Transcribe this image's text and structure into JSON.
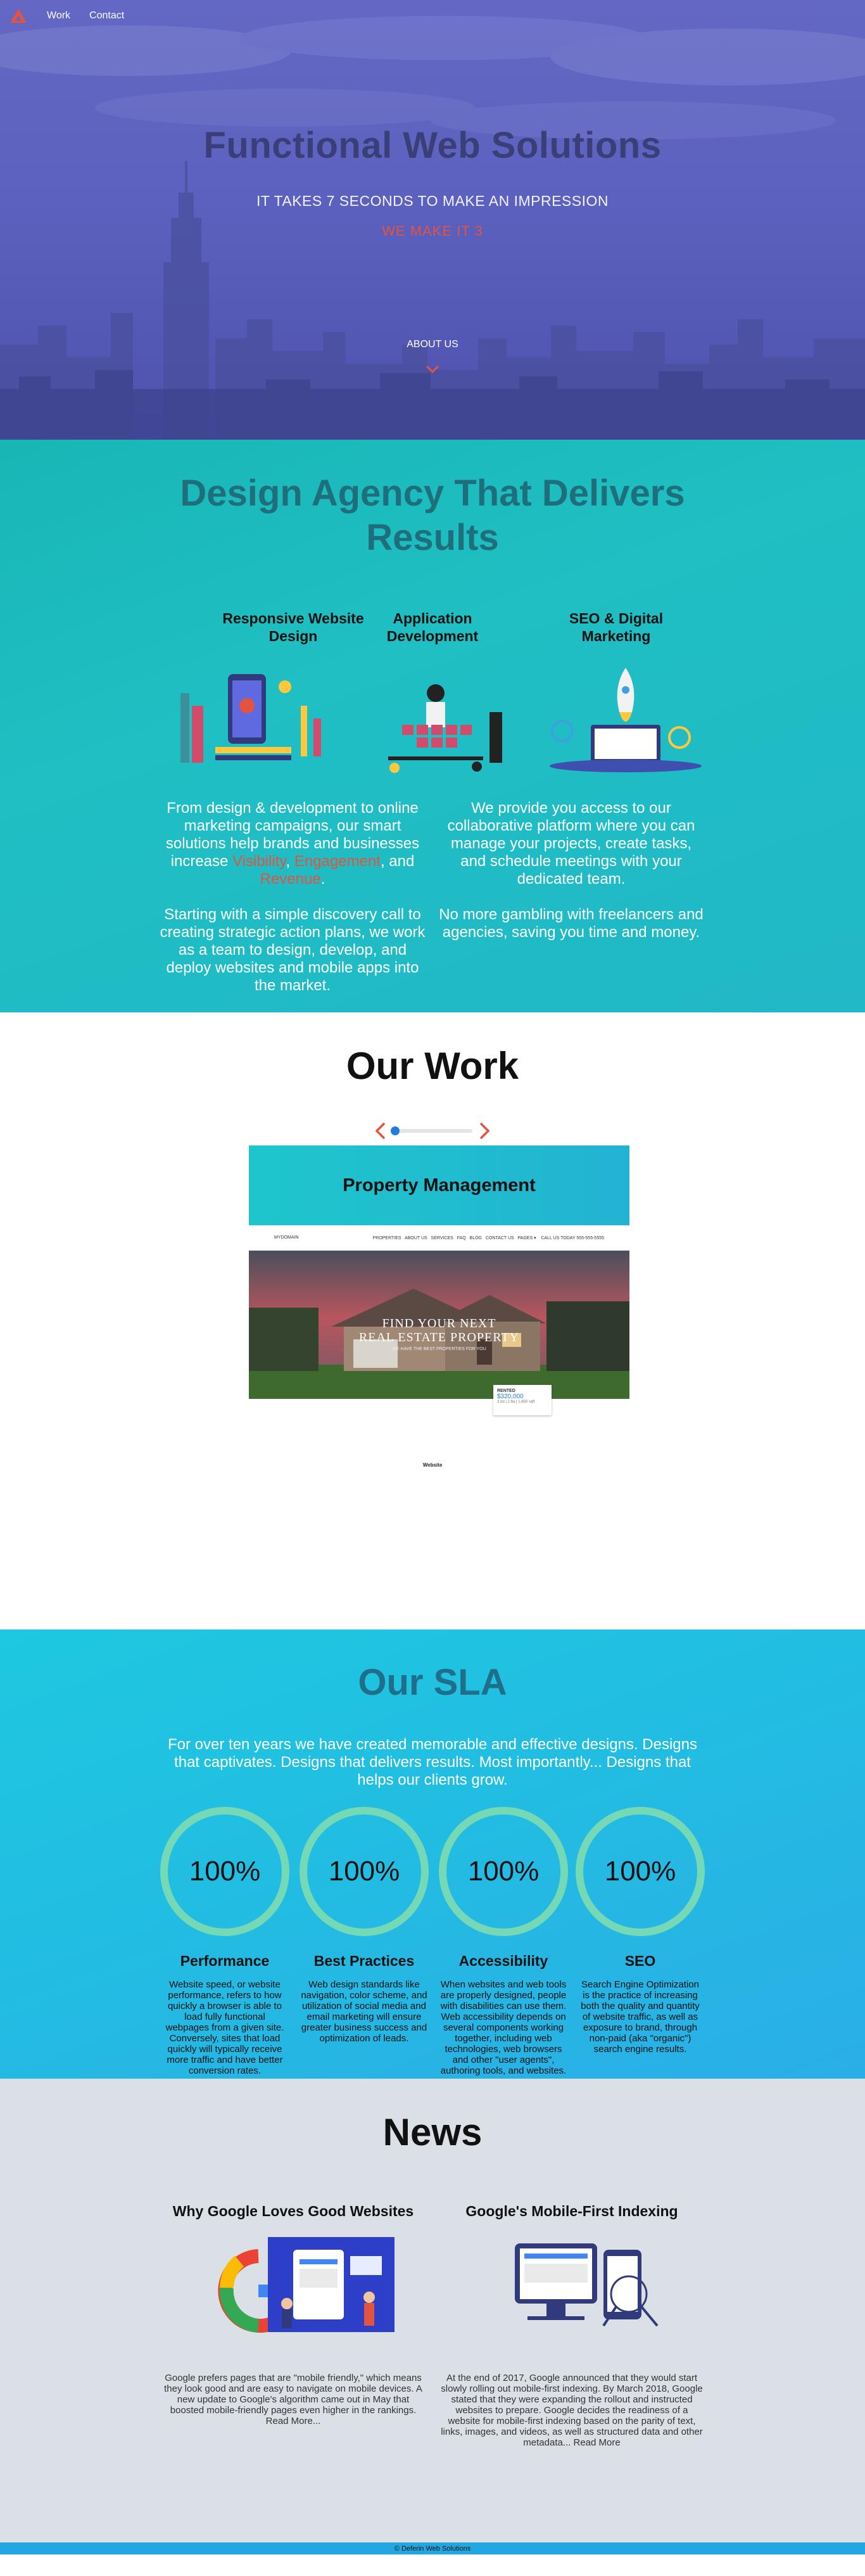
{
  "nav": {
    "links": [
      "Work",
      "Contact"
    ]
  },
  "hero": {
    "title": "Functional Web Solutions",
    "subtitle": "IT TAKES 7 SECONDS TO MAKE AN IMPRESSION",
    "tagline": "WE MAKE IT 3",
    "about_link": "ABOUT US"
  },
  "agency": {
    "title_line1": "Design Agency That Delivers",
    "title_line2": "Results",
    "services": [
      {
        "title_line1": "Responsive Website",
        "title_line2": "Design",
        "icon": "responsive-design-illustration"
      },
      {
        "title_line1": "Application",
        "title_line2": "Development",
        "icon": "app-development-illustration"
      },
      {
        "title_line1": "SEO & Digital",
        "title_line2": "Marketing",
        "icon": "seo-rocket-illustration"
      }
    ],
    "left": {
      "p1_start": "From design & development to online marketing campaigns, our smart solutions help brands and businesses increase ",
      "hl1": "Visibility",
      "sep1": ", ",
      "hl2": "Engagement",
      "sep2": ", and ",
      "hl3": "Revenue",
      "end": ".",
      "p2": "Starting with a simple discovery call to creating strategic action plans, we work as a team to design, develop, and deploy websites and mobile apps into the market."
    },
    "right": {
      "p1": "We provide you access to our collaborative platform where you can manage your projects, create tasks, and schedule meetings with your dedicated team.",
      "p2": "No more gambling with freelancers and agencies, saving you time and money."
    },
    "accent": "#e4533e"
  },
  "work": {
    "title": "Our Work",
    "slider_position": 0,
    "card_title": "Property Management",
    "mock": {
      "brand": "MYDOMAIN",
      "menu": [
        "PROPERTIES",
        "ABOUT US",
        "SERVICES",
        "FAQ",
        "BLOG",
        "CONTACT US",
        "PAGES ▾"
      ],
      "phone": "CALL US TODAY 555-555-5555",
      "caption_line1": "FIND YOUR NEXT",
      "caption_line2": "REAL ESTATE PROPERTY",
      "caption_small": "WE HAVE THE BEST PROPERTIES FOR YOU",
      "listing_label": "RENTED",
      "listing_price": "$320,000",
      "listing_meta": "3 bd | 2 ba | 1,850 sqft"
    },
    "footer_link": "Website"
  },
  "sla": {
    "title": "Our SLA",
    "intro": "For over ten years we have created memorable and effective designs. Designs that captivates. Designs that delivers results. Most importantly... Designs that helps our clients grow.",
    "items": [
      {
        "value": "100%",
        "percent": 100,
        "heading": "Performance",
        "text": "Website speed, or website performance, refers to how quickly a browser is able to load fully functional webpages from a given site. Conversely, sites that load quickly will typically receive more traffic and have better conversion rates."
      },
      {
        "value": "100%",
        "percent": 100,
        "heading": "Best Practices",
        "text": "Web design standards like navigation, color scheme, and utilization of social media and email marketing will ensure greater business success and optimization of leads."
      },
      {
        "value": "100%",
        "percent": 100,
        "heading": "Accessibility",
        "text": "When websites and web tools are properly designed, people with disabilities can use them. Web accessibility depends on several components working together, including web technologies, web browsers and other \"user agents\", authoring tools, and websites."
      },
      {
        "value": "100%",
        "percent": 100,
        "heading": "SEO",
        "text": "Search Engine Optimization is the practice of increasing both the quality and quantity of website traffic, as well as exposure to brand, through non-paid (aka \"organic\") search engine results."
      }
    ],
    "ring_color": "#76d9b5"
  },
  "news": {
    "title": "News",
    "articles": [
      {
        "heading": "Why Google Loves Good Websites",
        "icon": "google-logo-illustration",
        "text": "Google prefers pages that are \"mobile friendly,\" which means they look good and are easy to navigate on mobile devices. A new update to Google's algorithm came out in May that boosted mobile-friendly pages even higher in the rankings.",
        "read_more": "Read More..."
      },
      {
        "heading": "Google's Mobile-First Indexing",
        "icon": "mobile-indexing-illustration",
        "text": "At the end of 2017, Google announced that they would start slowly rolling out mobile-first indexing. By March 2018, Google stated that they were expanding the rollout and instructed websites to prepare. Google decides the readiness of a website for mobile-first indexing based on the parity of text, links, images, and videos, as well as structured data and other metadata...",
        "read_more": "Read More"
      }
    ]
  },
  "footer": {
    "text": "© Deferin Web Solutions"
  }
}
